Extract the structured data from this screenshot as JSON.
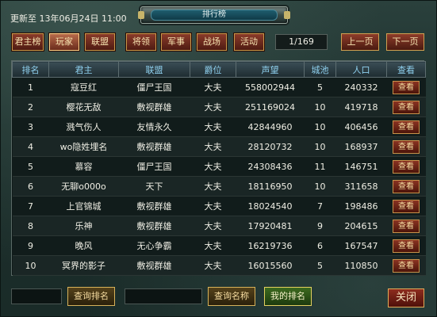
{
  "update_text": "更新至 13年06月24日 11:00",
  "title": "排行榜",
  "tabs": [
    "君主榜",
    "玩家",
    "联盟",
    "将领",
    "军事",
    "战场",
    "活动"
  ],
  "active_tab": "玩家",
  "pager": {
    "value": "1/169",
    "prev": "上一页",
    "next": "下一页"
  },
  "columns": [
    "排名",
    "君主",
    "联盟",
    "爵位",
    "声望",
    "城池",
    "人口",
    "查看"
  ],
  "rows": [
    {
      "rank": "1",
      "lord": "寇豆红",
      "alliance": "僵尸王国",
      "title": "大夫",
      "prestige": "558002944",
      "cities": "5",
      "population": "240332",
      "view": "查看"
    },
    {
      "rank": "2",
      "lord": "樱花无敌",
      "alliance": "敷视群雄",
      "title": "大夫",
      "prestige": "251169024",
      "cities": "10",
      "population": "419718",
      "view": "查看"
    },
    {
      "rank": "3",
      "lord": "溅气伤人",
      "alliance": "友情永久",
      "title": "大夫",
      "prestige": "42844960",
      "cities": "10",
      "population": "406456",
      "view": "查看"
    },
    {
      "rank": "4",
      "lord": "wo隐姓埋名",
      "alliance": "敷视群雄",
      "title": "大夫",
      "prestige": "28120732",
      "cities": "10",
      "population": "168937",
      "view": "查看"
    },
    {
      "rank": "5",
      "lord": "慕容",
      "alliance": "僵尸王国",
      "title": "大夫",
      "prestige": "24308436",
      "cities": "11",
      "population": "146751",
      "view": "查看"
    },
    {
      "rank": "6",
      "lord": "无聊o000o",
      "alliance": "天下",
      "title": "大夫",
      "prestige": "18116950",
      "cities": "10",
      "population": "311658",
      "view": "查看"
    },
    {
      "rank": "7",
      "lord": "上官锦城",
      "alliance": "敷视群雄",
      "title": "大夫",
      "prestige": "18024540",
      "cities": "7",
      "population": "198486",
      "view": "查看"
    },
    {
      "rank": "8",
      "lord": "乐神",
      "alliance": "敷视群雄",
      "title": "大夫",
      "prestige": "17920481",
      "cities": "9",
      "population": "204615",
      "view": "查看"
    },
    {
      "rank": "9",
      "lord": "晚风",
      "alliance": "无心争霸",
      "title": "大夫",
      "prestige": "16219736",
      "cities": "6",
      "population": "167547",
      "view": "查看"
    },
    {
      "rank": "10",
      "lord": "冥界的影子",
      "alliance": "敷视群雄",
      "title": "大夫",
      "prestige": "16015560",
      "cities": "5",
      "population": "110850",
      "view": "查看"
    }
  ],
  "footer": {
    "search_rank_label": "查询排名",
    "search_name_label": "查询名称",
    "my_rank_label": "我的排名",
    "close_label": "关闭"
  },
  "colors": {
    "header_text": "#8fd0ee",
    "button_red": "#8b3322",
    "button_border": "#c7924a"
  }
}
